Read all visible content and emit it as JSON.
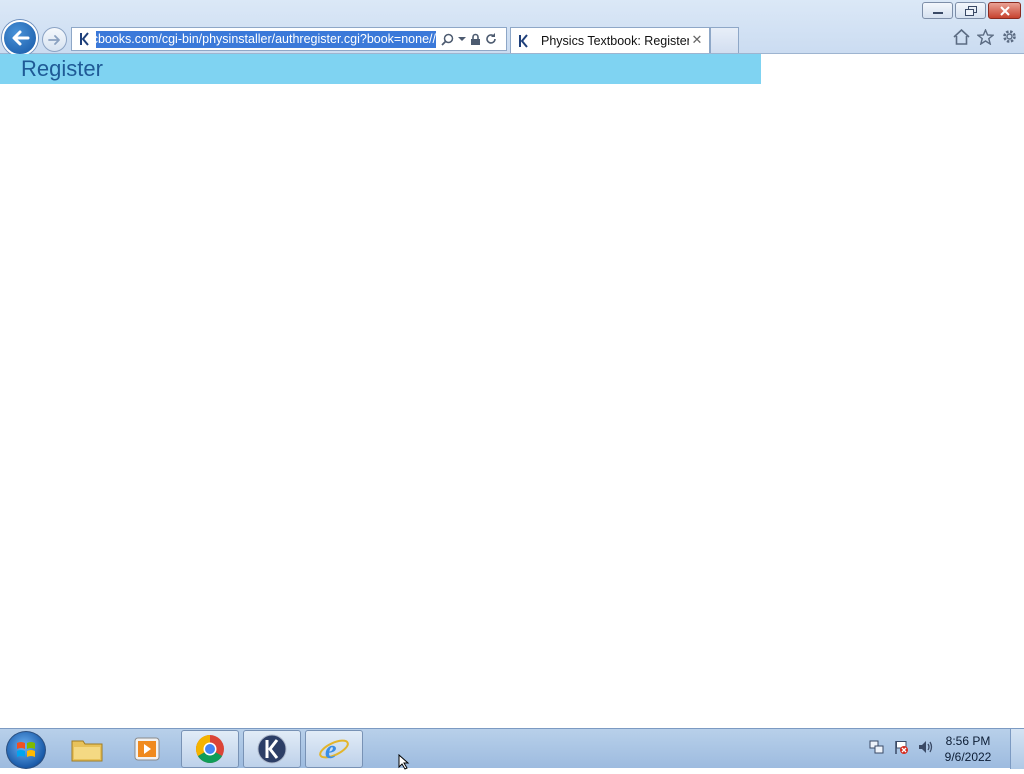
{
  "browser": {
    "url": "//sticbooks.com/cgi-bin/physinstaller/authregister.cgi?book=none",
    "tab_title": "Physics Textbook: Register",
    "tab_close_glyph": "✕",
    "icons": {
      "back": "back-arrow-icon",
      "forward": "forward-arrow-icon",
      "search": "search-icon",
      "dropdown": "chevron-down-icon",
      "lock": "lock-icon",
      "refresh": "refresh-icon",
      "home": "home-icon",
      "favorites": "star-icon",
      "settings": "gear-icon"
    }
  },
  "page": {
    "title": "Register",
    "header_color": "#7fd3f2",
    "title_color": "#1f5a96"
  },
  "taskbar": {
    "apps": [
      "file-explorer",
      "media-player",
      "chrome",
      "kiosk-app",
      "internet-explorer"
    ],
    "clock_time": "8:56 PM",
    "clock_date": "9/6/2022"
  }
}
